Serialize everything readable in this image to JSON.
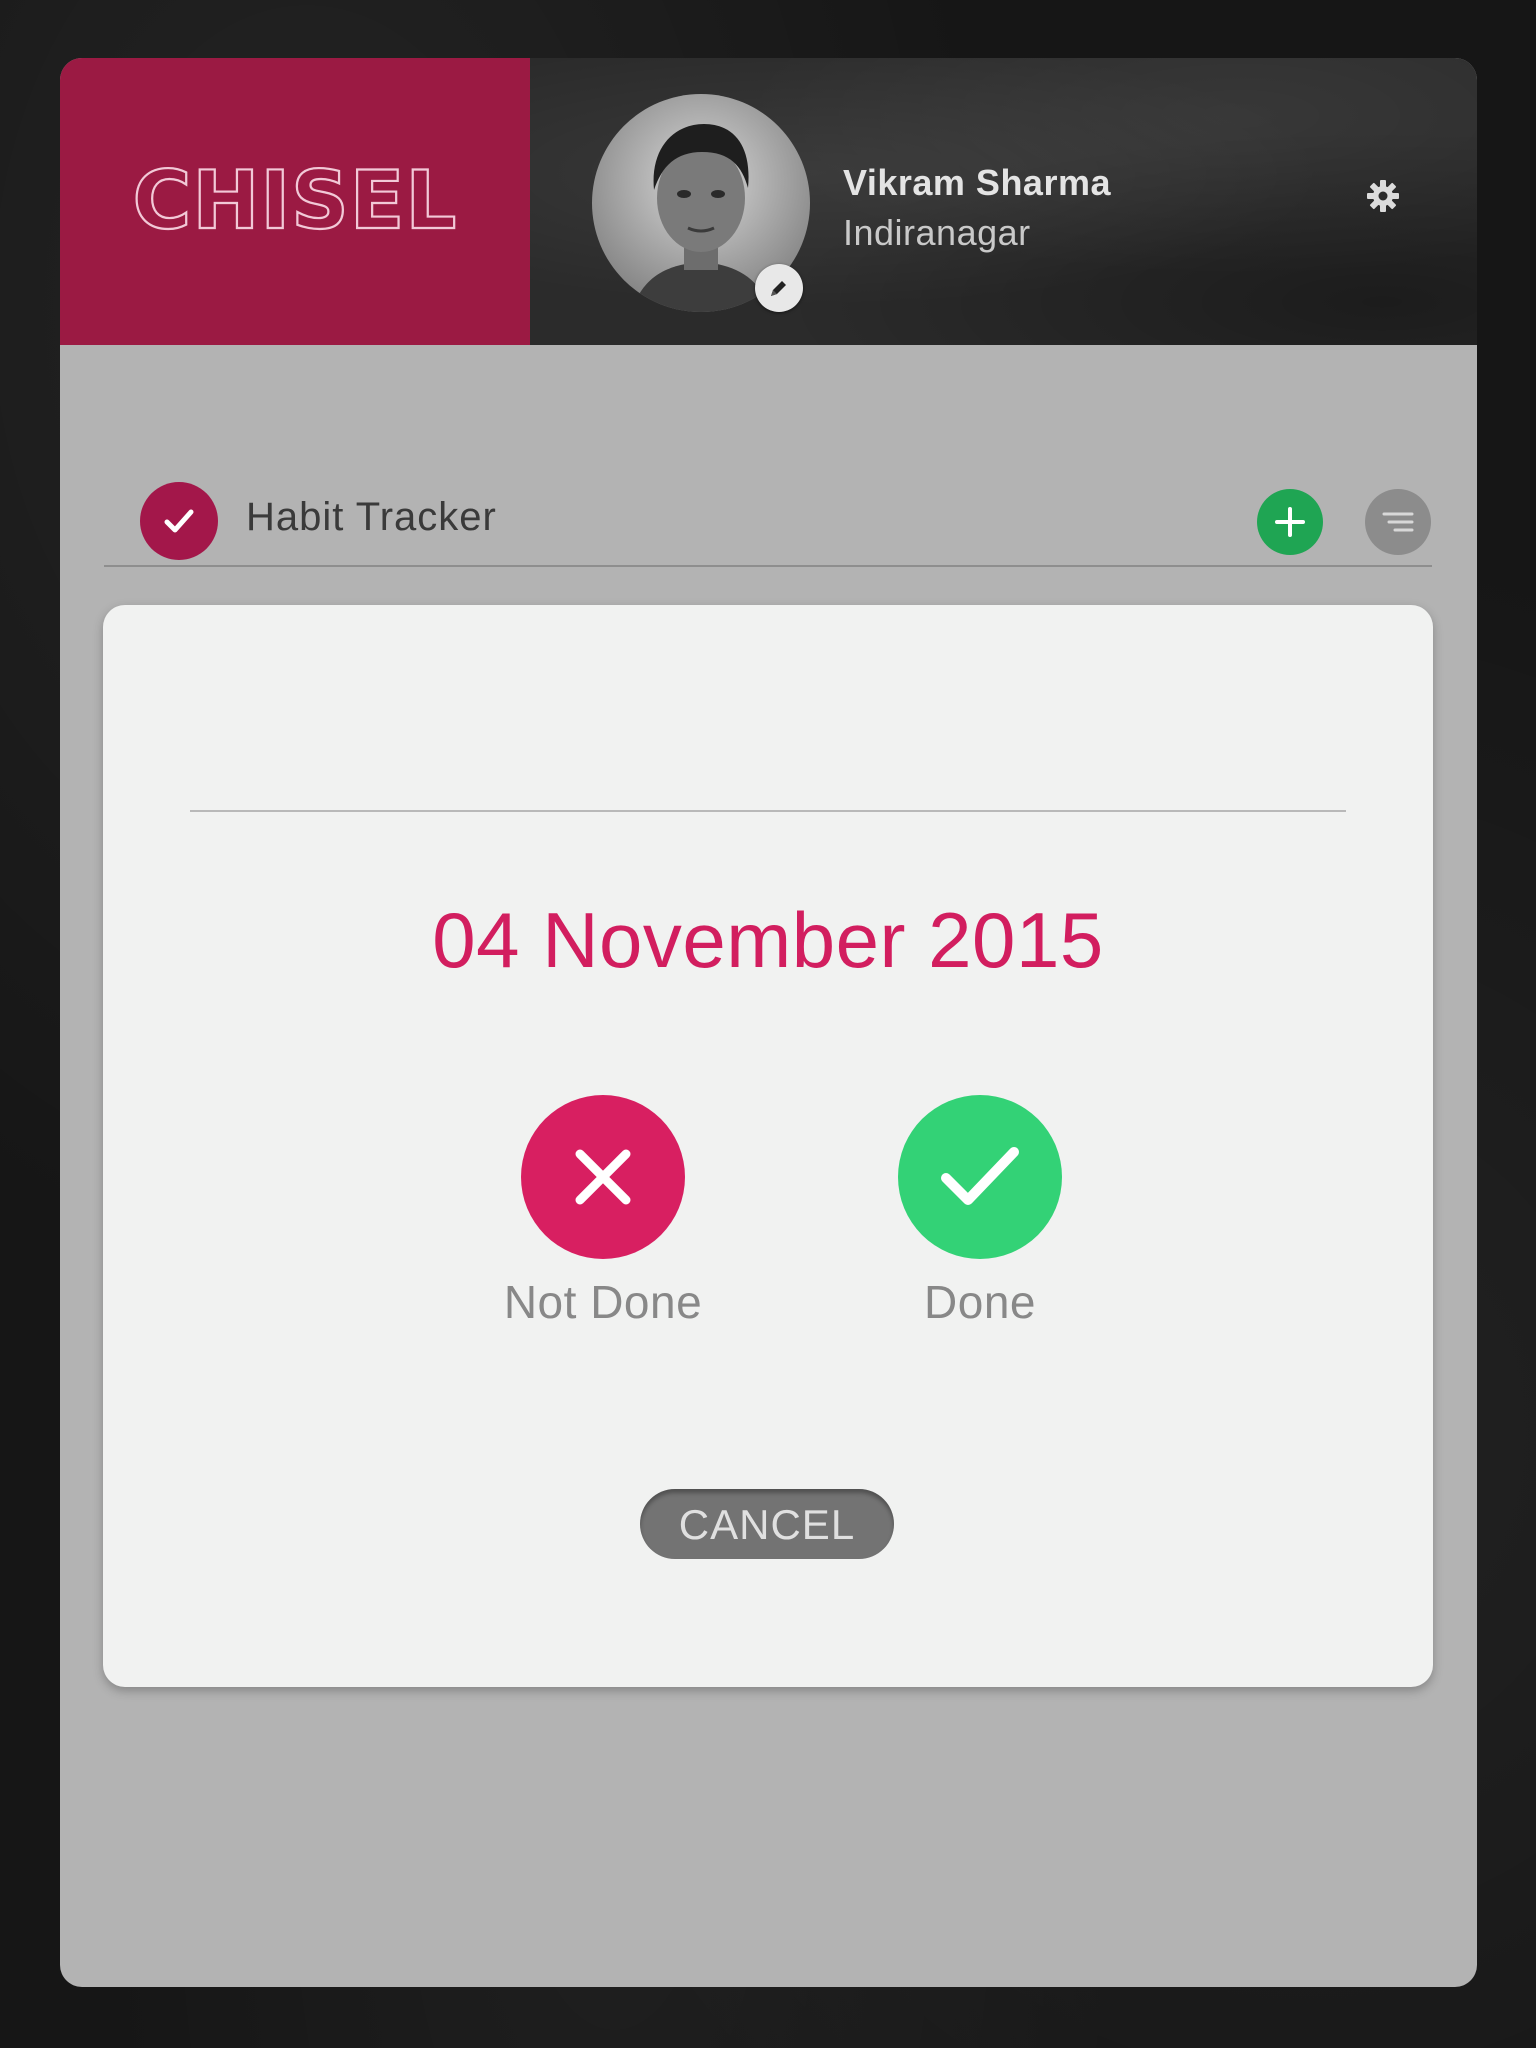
{
  "header": {
    "brand_name": "CHISEL",
    "user": {
      "name": "Vikram Sharma",
      "location": "Indiranagar"
    },
    "icons": {
      "edit": "pencil-icon",
      "settings": "gear-icon"
    }
  },
  "toolbar": {
    "title": "Habit Tracker",
    "icons": {
      "title": "checkmark-icon",
      "add": "plus-icon",
      "sort": "sort-lines-icon"
    }
  },
  "dialog": {
    "title": "",
    "date": "04 November 2015",
    "not_done_label": "Not Done",
    "done_label": "Done",
    "cancel_label": "CANCEL"
  },
  "colors": {
    "brand": "#9b1a43",
    "accent_pink": "#d21e5f",
    "done_green": "#33d276",
    "add_green": "#1fa553"
  }
}
